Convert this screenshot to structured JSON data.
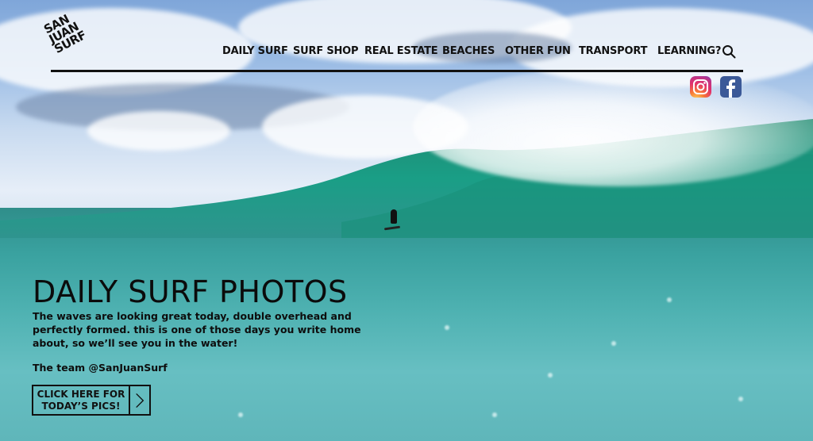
{
  "brand": {
    "logo_text": [
      "SAN",
      "JUAN",
      "SURF"
    ]
  },
  "nav": {
    "items": [
      {
        "label": "DAILY SURF"
      },
      {
        "label": "SURF SHOP"
      },
      {
        "label": "REAL ESTATE"
      },
      {
        "label": "BEACHES"
      },
      {
        "label": "OTHER FUN"
      },
      {
        "label": "TRANSPORT"
      },
      {
        "label": "LEARNING?"
      }
    ],
    "search_icon": "search-icon"
  },
  "social": {
    "icons": [
      "instagram-icon",
      "facebook-icon"
    ]
  },
  "hero": {
    "title": "DAILY SURF PHOTOS",
    "body": "The waves are looking great today, double overhead and perfectly formed. this is one of those days you write home about, so we’ll see you in the water!",
    "signoff": "The team @SanJuanSurf",
    "cta_line1": "CLICK HERE FOR",
    "cta_line2": "TODAY’S PICS!"
  }
}
